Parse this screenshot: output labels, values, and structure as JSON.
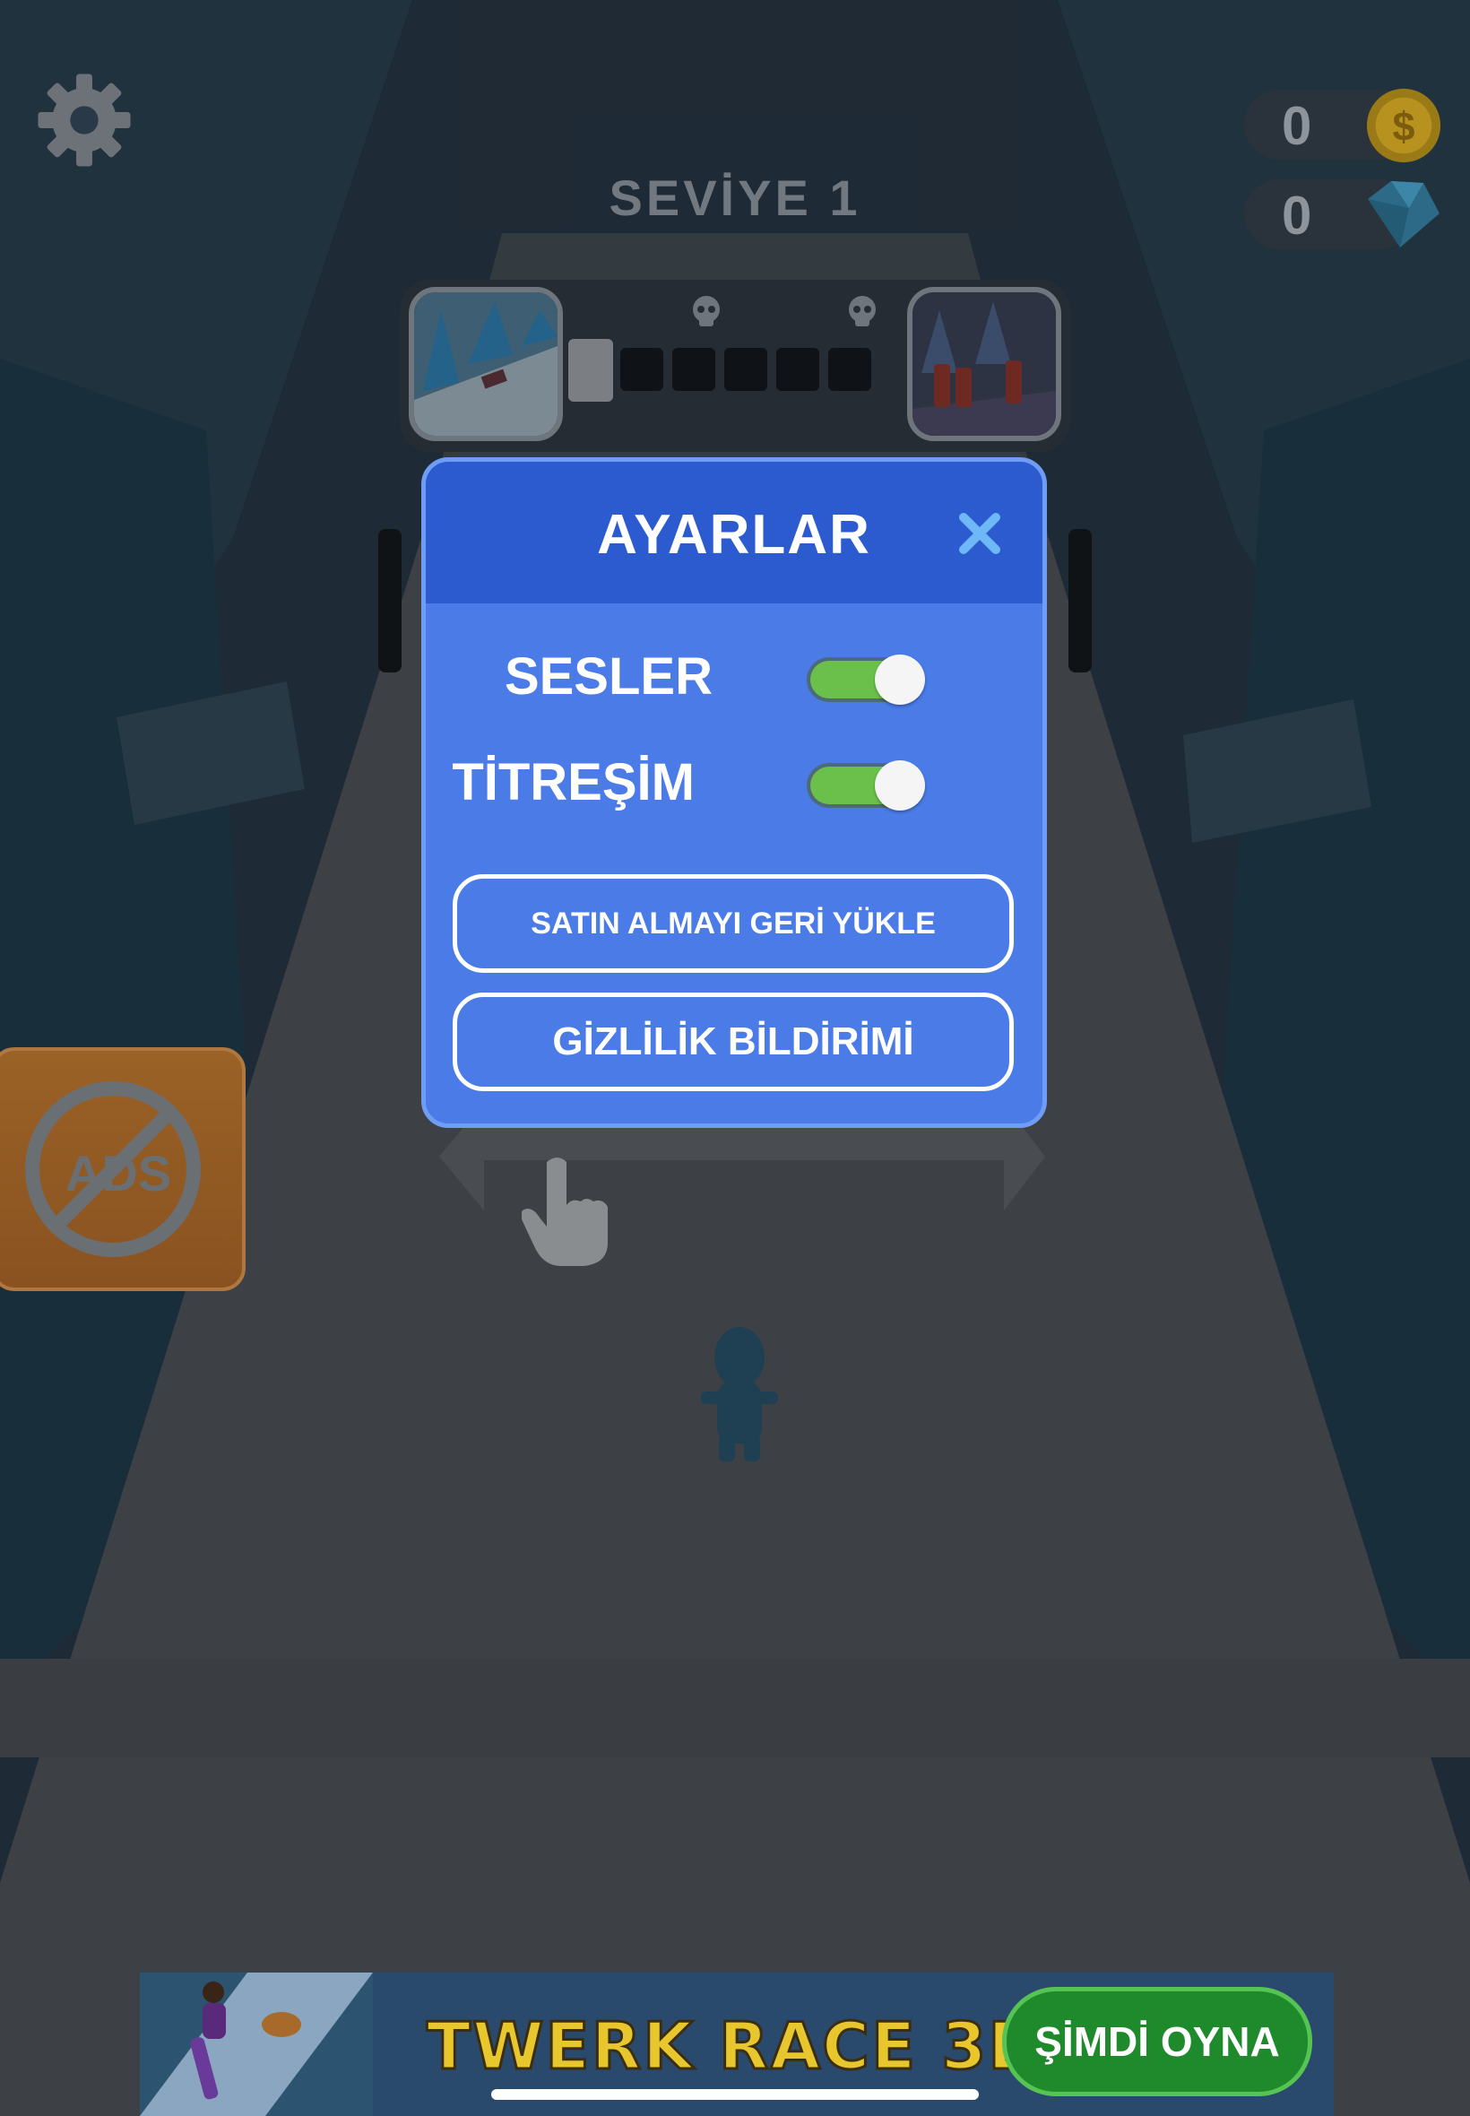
{
  "hud": {
    "level_title": "SEVİYE 1",
    "coins": "0",
    "gems": "0"
  },
  "settings_modal": {
    "title": "AYARLAR",
    "sounds_label": "SESLER",
    "sounds_on": true,
    "vibration_label": "TİTREŞİM",
    "vibration_on": true,
    "restore_purchase_label": "SATIN ALMAYI GERİ YÜKLE",
    "privacy_label": "GİZLİLİK BİLDİRİMİ"
  },
  "noads_badge": {
    "text": "ADS"
  },
  "ad_banner": {
    "title": "TWERK RACE 3D",
    "cta": "ŞİMDİ OYNA"
  },
  "colors": {
    "modal_body": "#4a7be6",
    "modal_header": "#2c5bd0",
    "toggle_on": "#6bc04b",
    "banner_cta": "#1f8a2c"
  },
  "icons": [
    "gear-icon",
    "coin-icon",
    "gem-icon",
    "skull-icon",
    "close-icon",
    "no-ads-icon",
    "hand-pointer-icon"
  ]
}
